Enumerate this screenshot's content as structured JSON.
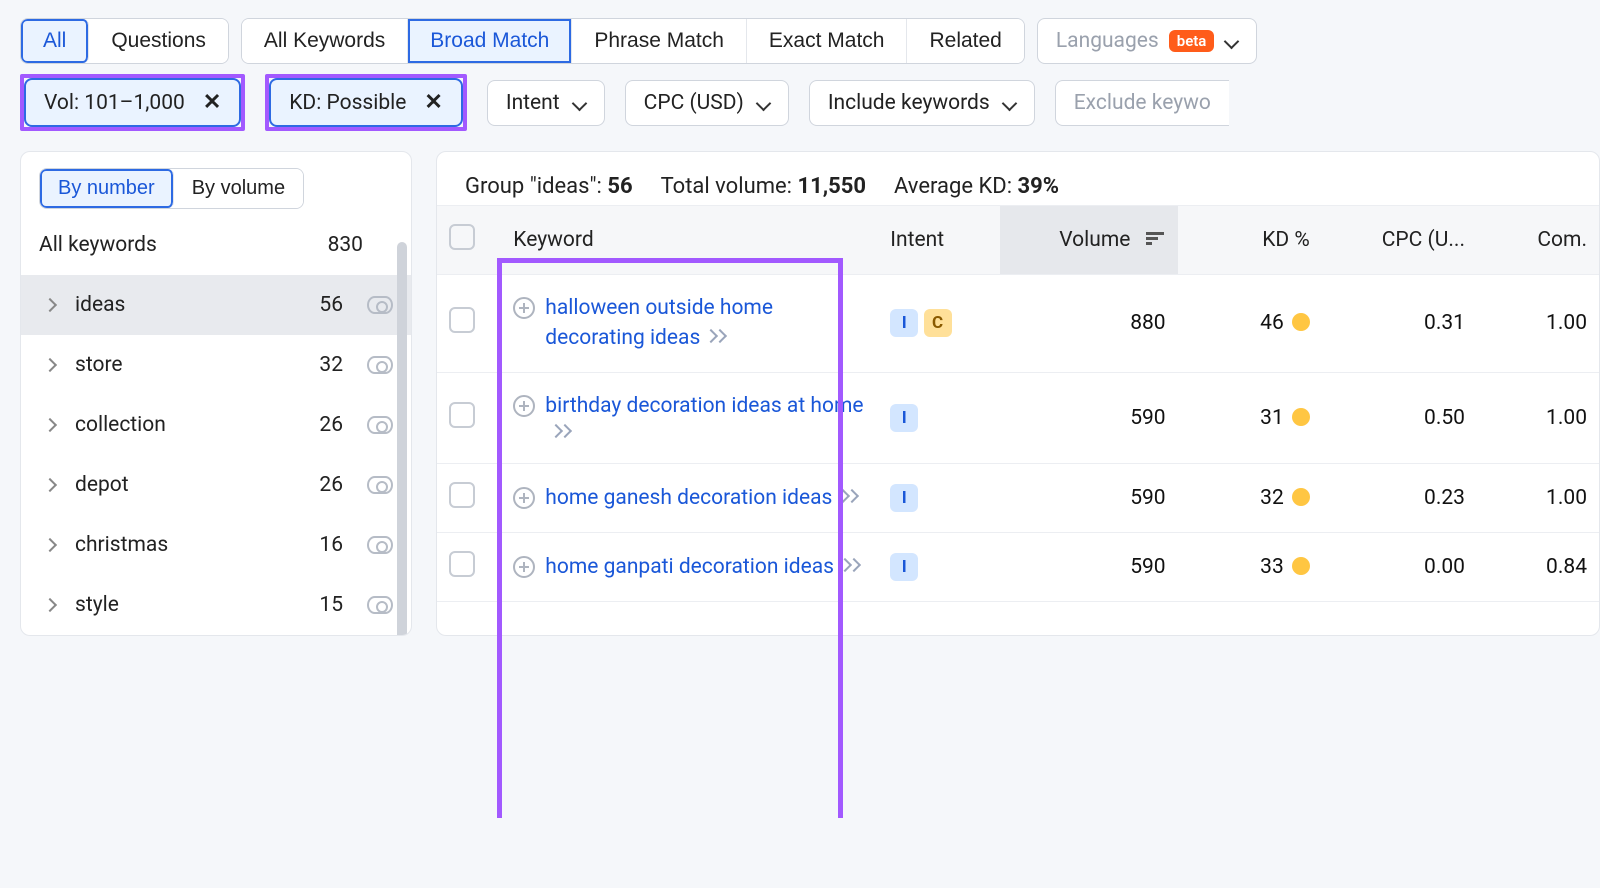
{
  "tabs_primary": {
    "all": "All",
    "questions": "Questions"
  },
  "tabs_match": {
    "all": "All Keywords",
    "broad": "Broad Match",
    "phrase": "Phrase Match",
    "exact": "Exact Match",
    "related": "Related"
  },
  "languages": {
    "label": "Languages",
    "badge": "beta"
  },
  "filters": {
    "vol": {
      "label": "Vol: 101–1,000"
    },
    "kd": {
      "label": "KD: Possible"
    },
    "intent": {
      "label": "Intent"
    },
    "cpc": {
      "label": "CPC (USD)"
    },
    "include": {
      "label": "Include keywords"
    },
    "exclude": {
      "label": "Exclude keywo"
    }
  },
  "sidebar": {
    "sort_by_number": "By number",
    "sort_by_volume": "By volume",
    "all_keywords_label": "All keywords",
    "all_keywords_count": "830",
    "groups": [
      {
        "name": "ideas",
        "count": "56"
      },
      {
        "name": "store",
        "count": "32"
      },
      {
        "name": "collection",
        "count": "26"
      },
      {
        "name": "depot",
        "count": "26"
      },
      {
        "name": "christmas",
        "count": "16"
      },
      {
        "name": "style",
        "count": "15"
      }
    ]
  },
  "stats": {
    "group_label": "Group \"ideas\": ",
    "group_count": "56",
    "total_volume_label": "Total volume: ",
    "total_volume": "11,550",
    "avg_kd_label": "Average KD: ",
    "avg_kd": "39%"
  },
  "table": {
    "headers": {
      "keyword": "Keyword",
      "intent": "Intent",
      "volume": "Volume",
      "kd": "KD %",
      "cpc": "CPC (U...",
      "com": "Com."
    },
    "rows": [
      {
        "keyword": "halloween outside home decorating ideas",
        "intents": [
          "I",
          "C"
        ],
        "volume": "880",
        "kd": "46",
        "cpc": "0.31",
        "com": "1.00"
      },
      {
        "keyword": "birthday decoration ideas at home",
        "intents": [
          "I"
        ],
        "volume": "590",
        "kd": "31",
        "cpc": "0.50",
        "com": "1.00"
      },
      {
        "keyword": "home ganesh decoration ideas",
        "intents": [
          "I"
        ],
        "volume": "590",
        "kd": "32",
        "cpc": "0.23",
        "com": "1.00"
      },
      {
        "keyword": "home ganpati decoration ideas",
        "intents": [
          "I"
        ],
        "volume": "590",
        "kd": "33",
        "cpc": "0.00",
        "com": "0.84"
      }
    ]
  }
}
